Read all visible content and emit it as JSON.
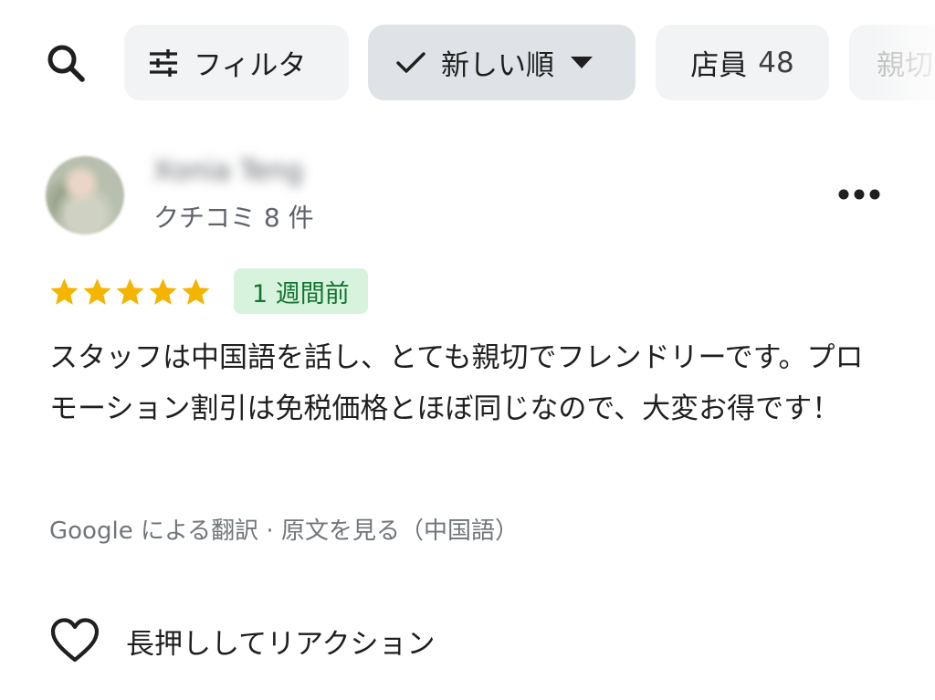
{
  "toolbar": {
    "search_icon": "search-icon",
    "chips": {
      "filter": {
        "icon": "tune-icon",
        "label": "フィルタ"
      },
      "sort": {
        "icon": "check-icon",
        "label": "新しい順",
        "caret": "caret-down-icon"
      },
      "staff": {
        "label": "店員",
        "count": "48"
      },
      "partial": {
        "label": "親切"
      }
    }
  },
  "review": {
    "reviewer": {
      "name": "Xonia Teng",
      "meta": "クチコミ 8 件"
    },
    "more_icon": "more-horiz-icon",
    "rating": 5,
    "star_color": "#f4b400",
    "time_badge": "1 週間前",
    "text": "スタッフは中国語を話し、とても親切でフレンドリーです。プロモーション割引は免税価格とほぼ同じなので、大変お得です！",
    "translation": {
      "prefix": "Google による翻訳",
      "separator": " · ",
      "link": "原文を見る（中国語）"
    },
    "reaction": {
      "icon": "heart-outline-icon",
      "label": "長押ししてリアクション"
    }
  }
}
